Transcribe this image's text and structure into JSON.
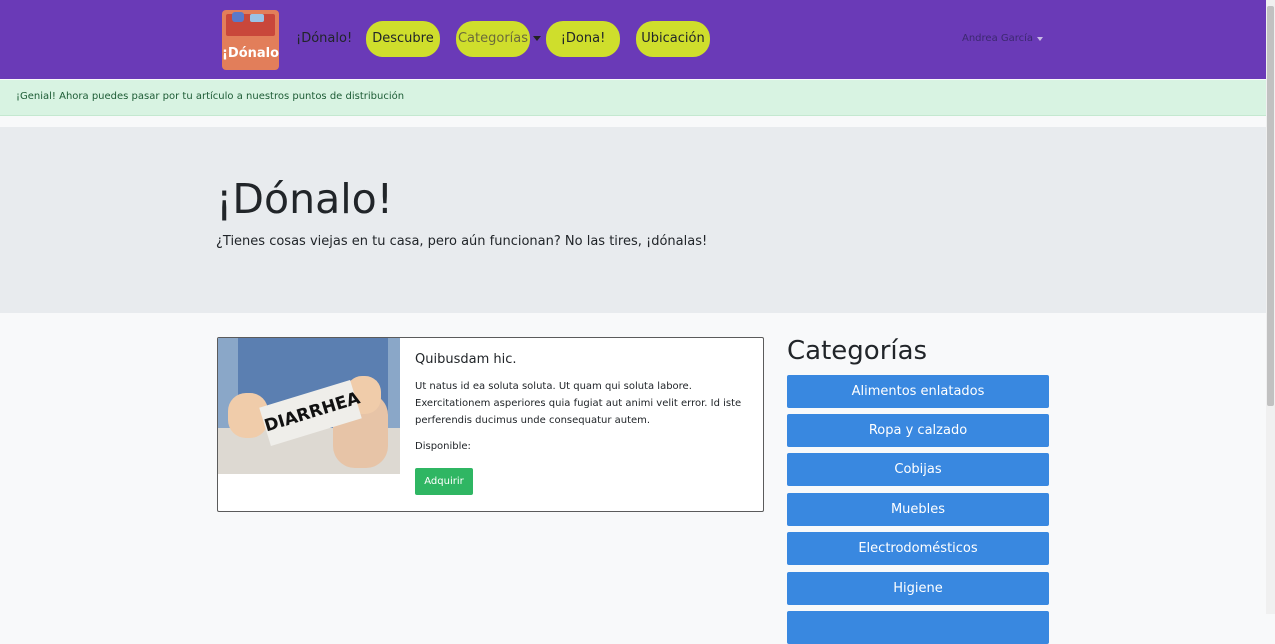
{
  "navbar": {
    "logo_text": "¡Dónalo!",
    "brand": "¡Dónalo!",
    "links": [
      "Descubre",
      "Categorías",
      "¡Dona!",
      "Ubicación"
    ],
    "user": "Andrea García",
    "color": "#6a3ab7",
    "pill_color": "#cfde2c"
  },
  "alert": {
    "message": "¡Genial! Ahora puedes pasar por tu artículo a nuestros puntos de distribución"
  },
  "jumbotron": {
    "title": "¡Dónalo!",
    "subtitle": "¿Tienes cosas viejas en tu casa, pero aún funcionan? No las tires, ¡dónalas!"
  },
  "card": {
    "image_text": "DIARRHEA",
    "title": "Quibusdam hic.",
    "description": "Ut natus id ea soluta soluta. Ut quam qui soluta labore. Exercitationem asperiores quia fugiat aut animi velit error. Id iste perferendis ducimus unde consequatur autem.",
    "availability": "Disponible:",
    "button": "Adquirir"
  },
  "categories": {
    "title": "Categorías",
    "items": [
      "Alimentos enlatados",
      "Ropa y calzado",
      "Cobijas",
      "Muebles",
      "Electrodomésticos",
      "Higiene"
    ],
    "color": "#3988e0"
  }
}
